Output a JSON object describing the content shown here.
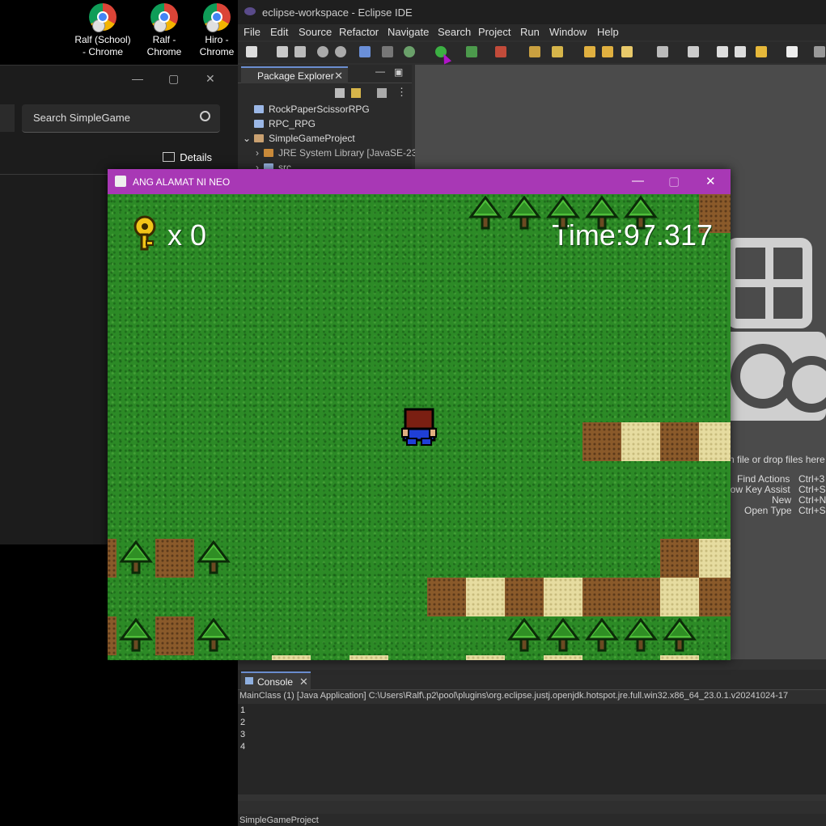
{
  "desktop": {
    "icons": [
      {
        "label": "Ralf (School)\n- Chrome"
      },
      {
        "label": "Ralf -\nChrome"
      },
      {
        "label": "Hiro -\nChrome"
      }
    ]
  },
  "explorer": {
    "search_placeholder": "Search SimpleGame",
    "details_label": "Details"
  },
  "eclipse": {
    "title": "eclipse-workspace - Eclipse IDE",
    "menu": [
      "File",
      "Edit",
      "Source",
      "Refactor",
      "Navigate",
      "Search",
      "Project",
      "Run",
      "Window",
      "Help"
    ],
    "package_explorer": {
      "tab_label": "Package Explorer",
      "items": [
        "RockPaperScissorRPG",
        "RPC_RPG",
        "SimpleGameProject",
        "JRE System Library [JavaSE-23]",
        "src"
      ]
    },
    "editor_hints": {
      "drop_text": "n file or drop files here",
      "shortcuts": [
        {
          "name": "Find Actions",
          "key": "Ctrl+3"
        },
        {
          "name": "now Key Assist",
          "key": "Ctrl+S"
        },
        {
          "name": "New",
          "key": "Ctrl+N"
        },
        {
          "name": "Open Type",
          "key": "Ctrl+S"
        }
      ]
    },
    "console": {
      "tab_label": "Console",
      "path": "MainClass (1) [Java Application] C:\\Users\\Ralf\\.p2\\pool\\plugins\\org.eclipse.justj.openjdk.hotspot.jre.full.win32.x86_64_23.0.1.v20241024-17",
      "lines": [
        "1",
        "2",
        "3",
        "4"
      ]
    },
    "status": "SimpleGameProject"
  },
  "game": {
    "window_title": "ANG ALAMAT NI NEO",
    "key_count": "x 0",
    "time": "Time:97.317",
    "colors": {
      "titlebar": "#a838b5",
      "grass": "#2c8a26"
    }
  }
}
